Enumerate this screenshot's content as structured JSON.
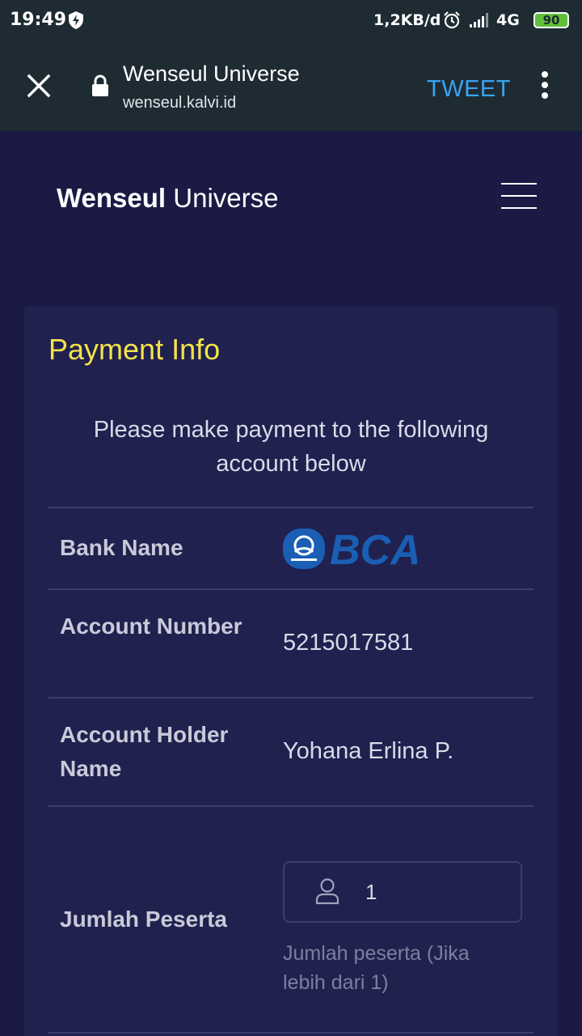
{
  "status_bar": {
    "time": "19:49",
    "speed": "1,2KB/d",
    "network": "4G",
    "battery": "90"
  },
  "browser": {
    "page_title": "Wenseul Universe",
    "url": "wenseul.kalvi.id",
    "action_label": "TWEET"
  },
  "site": {
    "title_bold": "Wenseul",
    "title_rest": "Universe"
  },
  "payment": {
    "heading": "Payment Info",
    "intro": "Please make payment to the following account below",
    "bank_name_label": "Bank Name",
    "bank_logo_text": "BCA",
    "account_number_label": "Account Number",
    "account_number": "5215017581",
    "holder_label": "Account Holder Name",
    "holder_name": "Yohana Erlina P.",
    "participants_label": "Jumlah Peserta",
    "participants_value": "1",
    "participants_hint": "Jumlah peserta (Jika lebih dari 1)"
  },
  "colors": {
    "page_background": "#1a1a44",
    "card_background": "#20214f",
    "heading_accent": "#f3e34a",
    "link_blue": "#3aa4f2",
    "bca_blue": "#1a5fb4"
  }
}
